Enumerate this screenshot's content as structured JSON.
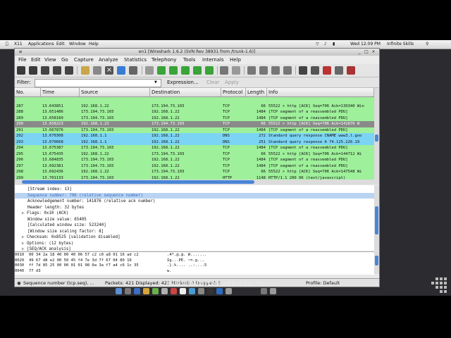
{
  "mac_menubar": {
    "items": [
      "X11",
      "Applications",
      "Edit",
      "Window",
      "Help"
    ],
    "clock": "Wed 12:09 PM",
    "user": "Infinite Skills"
  },
  "window": {
    "title": "en1  [Wireshark 1.6.2  (SVN Rev 38931 from /trunk-1.6)]"
  },
  "menu": [
    "File",
    "Edit",
    "View",
    "Go",
    "Capture",
    "Analyze",
    "Statistics",
    "Telephony",
    "Tools",
    "Internals",
    "Help"
  ],
  "filter": {
    "label": "Filter:",
    "value": "",
    "expression": "Expression...",
    "clear": "Clear",
    "apply": "Apply"
  },
  "columns": [
    "No.",
    "Time",
    "Source",
    "Destination",
    "Protocol",
    "Length",
    "Info"
  ],
  "packets": [
    {
      "no": "",
      "time": "",
      "src": "",
      "dst": "",
      "proto": "",
      "len": "",
      "info": "",
      "color": "#9ef09a"
    },
    {
      "no": "287",
      "time": "13.643851",
      "src": "192.168.1.22",
      "dst": "173.194.73.103",
      "proto": "TCP",
      "len": "66",
      "info": "55522 > http [ACK] Seq=706 Ack=139340 Win",
      "color": "#9ef09a"
    },
    {
      "no": "288",
      "time": "13.651486",
      "src": "173.194.73.103",
      "dst": "192.168.1.22",
      "proto": "TCP",
      "len": "1484",
      "info": "[TCP segment of a reassembled PDU]",
      "color": "#9ef09a"
    },
    {
      "no": "289",
      "time": "13.658189",
      "src": "173.194.73.103",
      "dst": "192.168.1.22",
      "proto": "TCP",
      "len": "1484",
      "info": "[TCP segment of a reassembled PDU]",
      "color": "#9ef09a"
    },
    {
      "no": "290",
      "time": "13.658223",
      "src": "192.168.1.22",
      "dst": "173.194.73.103",
      "proto": "TCP",
      "len": "66",
      "info": "55522 > http [ACK] Seq=706 Ack=141876 W",
      "color": "#8a8a8a"
    },
    {
      "no": "291",
      "time": "13.667876",
      "src": "173.194.73.103",
      "dst": "192.168.1.22",
      "proto": "TCP",
      "len": "1484",
      "info": "[TCP segment of a reassembled PDU]",
      "color": "#9ef09a"
    },
    {
      "no": "292",
      "time": "13.670308",
      "src": "192.168.1.1",
      "dst": "192.168.1.22",
      "proto": "DNS",
      "len": "272",
      "info": "Standard query response CNAME www3.l.goo",
      "color": "#7cd4f4"
    },
    {
      "no": "293",
      "time": "13.670668",
      "src": "192.168.1.1",
      "dst": "192.168.1.22",
      "proto": "DNS",
      "len": "251",
      "info": "Standard query response A 74.125.226.19",
      "color": "#7cd4f4"
    },
    {
      "no": "294",
      "time": "13.675387",
      "src": "173.194.73.103",
      "dst": "192.168.1.22",
      "proto": "TCP",
      "len": "1484",
      "info": "[TCP segment of a reassembled PDU]",
      "color": "#9ef09a"
    },
    {
      "no": "295",
      "time": "13.675435",
      "src": "192.168.1.22",
      "dst": "173.194.73.103",
      "proto": "TCP",
      "len": "66",
      "info": "55522 > http [ACK] Seq=706 Ack=144712 Wi",
      "color": "#9ef09a"
    },
    {
      "no": "296",
      "time": "13.684835",
      "src": "173.194.73.103",
      "dst": "192.168.1.22",
      "proto": "TCP",
      "len": "1484",
      "info": "[TCP segment of a reassembled PDU]",
      "color": "#9ef09a"
    },
    {
      "no": "297",
      "time": "13.692381",
      "src": "173.194.73.103",
      "dst": "192.168.1.22",
      "proto": "TCP",
      "len": "1484",
      "info": "[TCP segment of a reassembled PDU]",
      "color": "#9ef09a"
    },
    {
      "no": "298",
      "time": "13.692436",
      "src": "192.168.1.22",
      "dst": "173.194.73.103",
      "proto": "TCP",
      "len": "66",
      "info": "55522 > http [ACK] Seq=706 Ack=147548 Wi",
      "color": "#9ef09a"
    },
    {
      "no": "299",
      "time": "13.701133",
      "src": "173.194.73.103",
      "dst": "192.168.1.22",
      "proto": "HTTP",
      "len": "1148",
      "info": "HTTP/1.1 200 OK  (text/javascript)",
      "color": "#9ef09a"
    }
  ],
  "details": [
    {
      "text": "[Stream index: 13]",
      "indent": 2,
      "selected": false
    },
    {
      "text": "Sequence number: 706    (relative sequence number)",
      "indent": 2,
      "selected": true
    },
    {
      "text": "Acknowledgement number: 141876    (relative ack number)",
      "indent": 2,
      "selected": false
    },
    {
      "text": "Header length: 32 bytes",
      "indent": 2,
      "selected": false
    },
    {
      "text": "▷ Flags: 0x10 (ACK)",
      "indent": 0,
      "selected": false
    },
    {
      "text": "Window size value: 65405",
      "indent": 2,
      "selected": false
    },
    {
      "text": "[Calculated window size: 523240]",
      "indent": 2,
      "selected": false
    },
    {
      "text": "[Window size scaling factor: 8]",
      "indent": 2,
      "selected": false
    },
    {
      "text": "▷ Checksum: 0x8525 [validation disabled]",
      "indent": 0,
      "selected": false
    },
    {
      "text": "▷ Options: (12 bytes)",
      "indent": 0,
      "selected": false
    },
    {
      "text": "▷ [SEQ/ACK analysis]",
      "indent": 0,
      "selected": false
    }
  ],
  "hex": [
    {
      "off": "0010",
      "bytes": "00 34 2a 18 40 00 40 06  57 c2 c0 a8 01 16 ad c2",
      "ascii": ".4*.@.@. W......."
    },
    {
      "off": "0020",
      "bytes": "49 67 d8 e2 00 50 45 f4  7e 3d 7f 67 04 80 10",
      "ascii": "Ig...PE. ~=.g..."
    },
    {
      "off": "0030",
      "bytes": "ff 7d 85 25 00 00 01 01  08 0a 3a f7 a4 c6 1c 35",
      "ascii": ".}.%.... ..:....5"
    },
    {
      "off": "0040",
      "bytes": "77 d3",
      "ascii": "w."
    }
  ],
  "status": {
    "field": "Sequence number (tcp.seq), ...",
    "packets": "Packets: 421 Displayed: 421 Marked: 0 Dropped: 0",
    "profile": "Profile: Default"
  },
  "watermark": "www.WhiteHatAdda.in"
}
